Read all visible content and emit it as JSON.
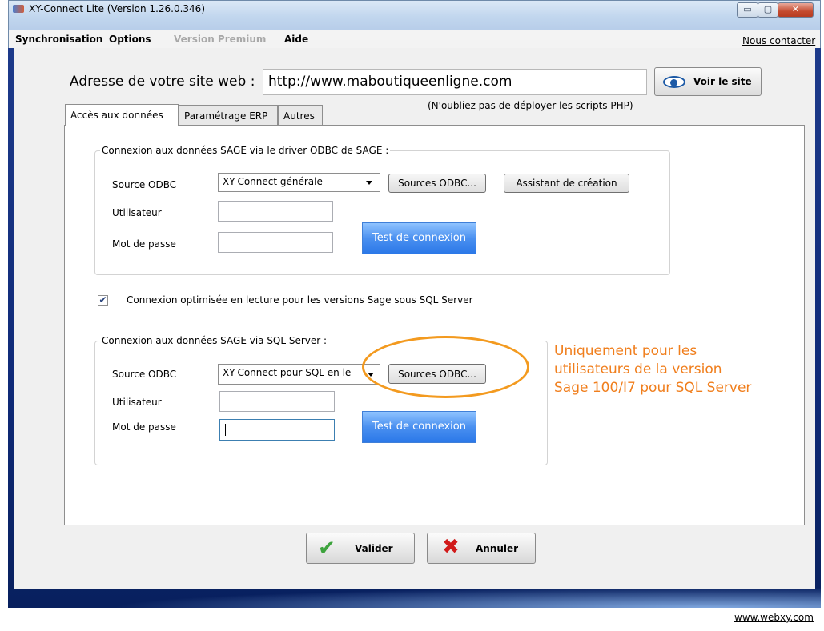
{
  "window": {
    "title": "XY-Connect Lite (Version 1.26.0.346)",
    "controls": {
      "minimize": "▭",
      "maximize": "▢",
      "close": "✕"
    }
  },
  "menu": {
    "items": [
      "Synchronisation",
      "Options",
      "Version Premium",
      "Aide"
    ],
    "disabled_item": "Version Premium",
    "contact_link": "Nous contacter"
  },
  "site": {
    "label": "Adresse de votre site web :",
    "url": "http://www.maboutiqueenligne.com",
    "view_button": "Voir le site",
    "php_note": "(N'oubliez pas de déployer les scripts PHP)"
  },
  "tabs": [
    {
      "label": "Accès aux données",
      "selected": true
    },
    {
      "label": "Paramétrage ERP",
      "selected": false
    },
    {
      "label": "Autres",
      "selected": false
    }
  ],
  "odbc_group": {
    "title": "Connexion aux données SAGE via le driver ODBC de SAGE :",
    "source_label": "Source ODBC",
    "source_value": "XY-Connect générale",
    "sources_button": "Sources ODBC...",
    "assistant_button": "Assistant de création",
    "user_label": "Utilisateur",
    "user_value": "",
    "password_label": "Mot de passe",
    "password_value": "",
    "test_button": "Test de connexion"
  },
  "optimized_checkbox": {
    "checked": true,
    "label": "Connexion optimisée en lecture pour les versions Sage sous SQL Server"
  },
  "sql_group": {
    "title": "Connexion aux données SAGE via SQL Server :",
    "source_label": "Source ODBC",
    "source_value": "XY-Connect pour SQL en le",
    "sources_button": "Sources ODBC...",
    "user_label": "Utilisateur",
    "user_value": "",
    "password_label": "Mot de passe",
    "password_value": "",
    "test_button": "Test de connexion"
  },
  "annotation": {
    "lines": [
      "Uniquement pour les",
      "utilisateurs de la version",
      "Sage 100/I7 pour SQL Server"
    ],
    "color": "#f07e1c"
  },
  "actions": {
    "validate": "Valider",
    "cancel": "Annuler"
  },
  "footer": {
    "link": "www.webxy.com"
  },
  "colors": {
    "test_button": "#3f8cf0",
    "annotation_ellipse": "#f39a1f",
    "frame": "#14307e"
  }
}
